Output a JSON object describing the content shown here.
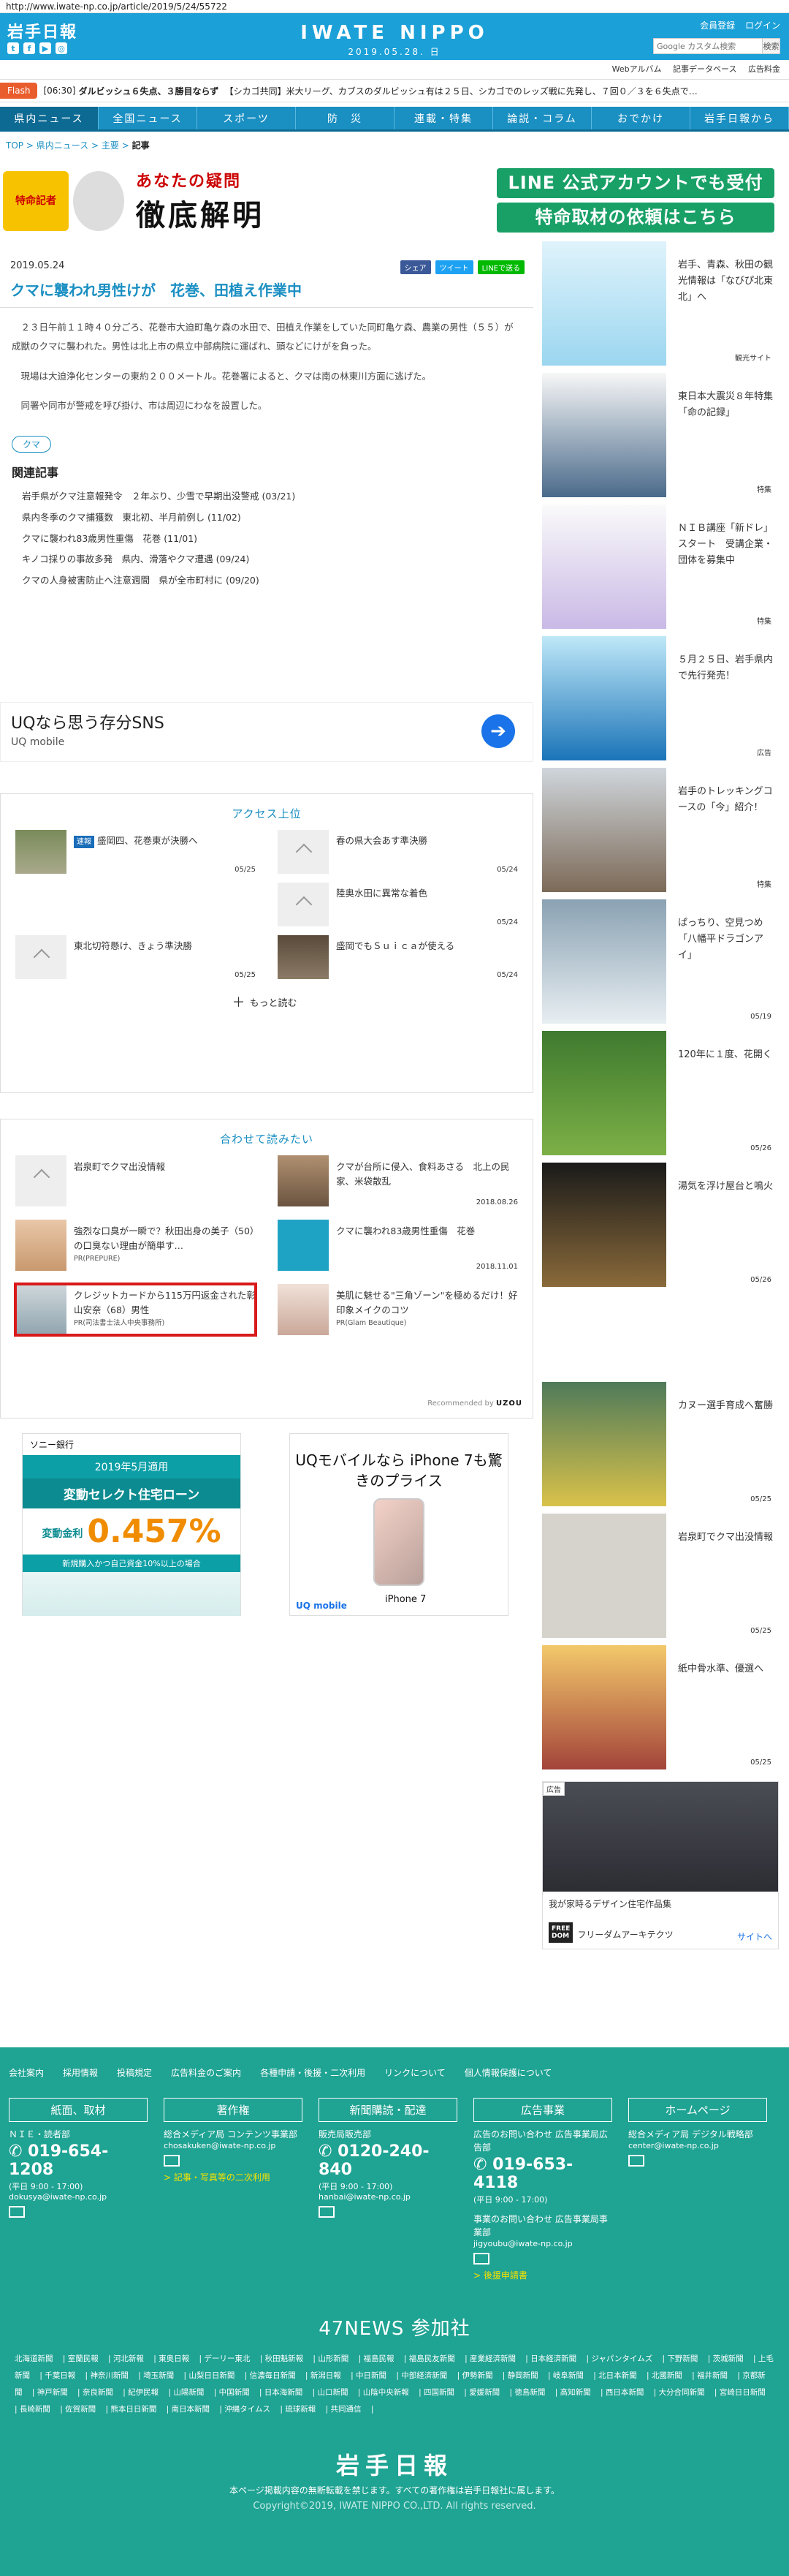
{
  "browser": {
    "url": "http://www.iwate-np.co.jp/article/2019/5/24/55722"
  },
  "header": {
    "logo_jp": "岩手日報",
    "brand": "IWATE NIPPO",
    "date": "2019.05.28. 日",
    "member_link": "会員登録",
    "login_link": "ログイン",
    "search_placeholder": "Google カスタム検索",
    "search_button": "検索",
    "sub_links": [
      "Webアルバム",
      "記事データベース",
      "広告料金"
    ]
  },
  "flash": {
    "label": "Flash",
    "time": "[06:30]",
    "headline": "ダルビッシュ６失点、３勝目ならず",
    "text": "【シカゴ共同】米大リーグ、カブスのダルビッシュ有は２５日、シカゴでのレッズ戦に先発し、７回０／３を６失点で…"
  },
  "nav": [
    "県内ニュース",
    "全国ニュース",
    "スポーツ",
    "防　災",
    "連載・特集",
    "論説・コラム",
    "おでかけ",
    "岩手日報から"
  ],
  "breadcrumb": {
    "top": "TOP",
    "sep": ">",
    "cat": "県内ニュース",
    "sub": "主要",
    "current": "記事"
  },
  "banner": {
    "char_label": "特命記者",
    "main_small": "あなたの疑問",
    "main": "徹底解明",
    "cta1": "LINE 公式アカウントでも受付",
    "cta2": "特命取材の依頼はこちら"
  },
  "article": {
    "date": "2019.05.24",
    "share_fb": "シェア",
    "share_tw": "ツイート",
    "share_line": "LINEで送る",
    "title": "クマに襲われ男性けが　花巻、田植え作業中",
    "paragraphs": [
      "２３日午前１１時４０分ごろ、花巻市大迫町亀ケ森の水田で、田植え作業をしていた同町亀ケ森、農業の男性（５５）が成獣のクマに襲われた。男性は北上市の県立中部病院に運ばれ、頭などにけがを負った。",
      "現場は大迫浄化センターの東約２００メートル。花巻署によると、クマは南の林東川方面に逃げた。",
      "同署や同市が警戒を呼び掛け、市は周辺にわなを設置した。"
    ],
    "tag": "クマ",
    "related_title": "関連記事",
    "related": [
      "岩手県がクマ注意報発令　２年ぶり、少雪で早期出没警戒 (03/21)",
      "県内冬季のクマ捕獲数　東北初、半月前例し (11/02)",
      "クマに襲われ83歳男性重傷　花巻 (11/01)",
      "キノコ採りの事故多発　県内、滑落やクマ遭遇 (09/24)",
      "クマの人身被害防止へ注意週間　県が全市町村に (09/20)"
    ]
  },
  "ad_uq": {
    "title": "UQなら思う存分SNS",
    "sub": "UQ mobile"
  },
  "access": {
    "title": "アクセス上位",
    "items": [
      {
        "badge": "速報",
        "text": "盛岡四、花巻東が決勝へ",
        "date": "05/25"
      },
      {
        "badge": "",
        "text": "春の県大会あす準決勝",
        "date": "05/24"
      },
      {
        "badge": "",
        "text": "",
        "date": ""
      },
      {
        "badge": "",
        "text": "陸奥水田に異常な着色",
        "date": "05/24"
      },
      {
        "badge": "",
        "text": "東北切符懸け、きょう準決勝",
        "date": "05/25"
      },
      {
        "badge": "",
        "text": "盛岡でもＳｕｉｃａが使える",
        "date": "05/24"
      }
    ],
    "more": "もっと読む"
  },
  "together": {
    "title": "合わせて読みたい",
    "items": [
      {
        "text": "岩泉町でクマ出没情報",
        "date": "",
        "pr": ""
      },
      {
        "text": "クマが台所に侵入、食料あさる　北上の民家、米袋散乱",
        "date": "2018.08.26",
        "pr": ""
      },
      {
        "text": "強烈な口臭が一瞬で？秋田出身の美子（50）の口臭ない理由が簡単す…",
        "date": "",
        "pr": "PR(PREPURE)"
      },
      {
        "text": "クマに襲われ83歳男性重傷　花巻",
        "date": "2018.11.01",
        "pr": ""
      },
      {
        "text": "クレジットカードから115万円返金された彰山安奈（68）男性",
        "date": "",
        "pr": "PR(司法書士法人中央事務所)"
      },
      {
        "text": "美肌に魅せる\"三角ゾーン\"を極めるだけ！好印象メイクのコツ",
        "date": "",
        "pr": "PR(Glam Beautique)"
      }
    ],
    "recommended": "Recommended by",
    "recommended_brand": "UZOU"
  },
  "ad_sony": {
    "brand": "ソニー銀行",
    "band": "2019年5月適用",
    "headline": "変動セレクト住宅ローン",
    "rate_label": "変動金利",
    "rate": "0.457%",
    "foot": "新規購入かつ自己資金10%以上の場合"
  },
  "ad_uq2": {
    "text": "UQモバイルなら iPhone 7も驚きのプライス",
    "logo": "UQ mobile",
    "model": "iPhone 7"
  },
  "sidebar": [
    {
      "text": "岩手、青森、秋田の観光情報は「なびぴ北東北」へ",
      "date": "観光サイト"
    },
    {
      "text": "東日本大震災８年特集　「命の記録」",
      "date": "特集"
    },
    {
      "text": "ＮＩＢ講座「新ドレ」スタート　受講企業・団体を募集中",
      "date": "特集"
    },
    {
      "text": "５月２５日、岩手県内で先行発売！",
      "date": "広告"
    },
    {
      "text": "岩手のトレッキングコースの「今」紹介！",
      "date": "特集"
    },
    {
      "text": "ぱっちり、空見つめ　「八幡平ドラゴンアイ」",
      "date": "05/19"
    },
    {
      "text": "120年に１度、花開く",
      "date": "05/26"
    },
    {
      "text": "湯気を浮け屋台と鳴火",
      "date": "05/26"
    },
    {
      "text": "カヌー選手育成へ奮勝",
      "date": "05/25"
    },
    {
      "text": "岩泉町でクマ出没情報",
      "date": "05/25"
    },
    {
      "text": "紙中骨水準、優選へ",
      "date": "05/25"
    }
  ],
  "side_ad": {
    "tag": "広告",
    "caption": "我が家時るデザイン住宅作品集",
    "sponsor": "フリーダムアーキテクツ",
    "site": "サイトへ"
  },
  "footer": {
    "links": [
      "会社案内",
      "採用情報",
      "投稿規定",
      "広告料金のご案内",
      "各種申請・後援・二次利用",
      "リンクについて",
      "個人情報保護について"
    ],
    "cols": [
      {
        "head": "紙面、取材",
        "l1": "ＮＩＥ・読者部",
        "tel": "019-654-1208",
        "hours": "(平日 9:00 - 17:00)",
        "email": "dokusya@iwate-np.co.jp",
        "extra": ""
      },
      {
        "head": "著作権",
        "l1": "総合メディア局 コンテンツ事業部",
        "tel": "",
        "hours": "",
        "email": "chosakuken@iwate-np.co.jp",
        "extra": "> 記事・写真等の二次利用"
      },
      {
        "head": "新聞購読・配達",
        "l1": "販売局販売部",
        "tel": "0120-240-840",
        "hours": "(平日 9:00 - 17:00)",
        "email": "hanbai@iwate-np.co.jp",
        "extra": ""
      },
      {
        "head": "広告事業",
        "l1": "広告のお問い合わせ 広告事業局広告部",
        "tel": "019-653-4118",
        "hours": "(平日 9:00 - 17:00)",
        "email": "jigyoubu@iwate-np.co.jp",
        "extra": "> 後援申請書"
      },
      {
        "head": "ホームページ",
        "l1": "総合メディア局 デジタル戦略部",
        "tel": "",
        "hours": "",
        "email": "center@iwate-np.co.jp",
        "extra": ""
      }
    ],
    "col4_extra": "事業のお問い合わせ 広告事業局事業部",
    "news47": "47NEWS 参加社",
    "papers": [
      "北海道新聞",
      "室蘭民報",
      "河北新報",
      "東奥日報",
      "デーリー東北",
      "秋田魁新報",
      "山形新聞",
      "福島民報",
      "福島民友新聞",
      "産業経済新聞",
      "日本経済新聞",
      "ジャパンタイムズ",
      "下野新聞",
      "茨城新聞",
      "上毛新聞",
      "千葉日報",
      "神奈川新聞",
      "埼玉新聞",
      "山梨日日新聞",
      "信濃毎日新聞",
      "新潟日報",
      "中日新聞",
      "中部経済新聞",
      "伊勢新聞",
      "静岡新聞",
      "岐阜新聞",
      "北日本新聞",
      "北國新聞",
      "福井新聞",
      "京都新聞",
      "神戸新聞",
      "奈良新聞",
      "紀伊民報",
      "山陽新聞",
      "中国新聞",
      "日本海新聞",
      "山口新聞",
      "山陰中央新報",
      "四国新聞",
      "愛媛新聞",
      "徳島新聞",
      "高知新聞",
      "西日本新聞",
      "大分合同新聞",
      "宮崎日日新聞",
      "長崎新聞",
      "佐賀新聞",
      "熊本日日新聞",
      "南日本新聞",
      "沖縄タイムス",
      "琉球新報",
      "共同通信"
    ],
    "logo": "岩手日報",
    "note": "本ページ掲載内容の無断転載を禁じます。すべての著作権は岩手日報社に属します。",
    "copyright": "Copyright©2019, IWATE NIPPO CO.,LTD. All rights reserved."
  }
}
